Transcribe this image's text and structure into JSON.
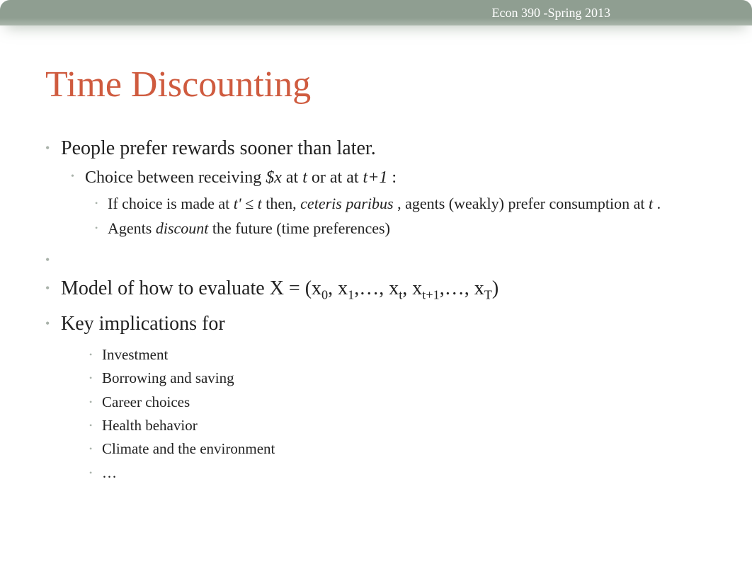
{
  "header": {
    "course": "Econ 390 -Spring 2013"
  },
  "title": "Time Discounting",
  "bullets": {
    "b1": "People prefer rewards sooner than later.",
    "b1_1_pre": "Choice between receiving ",
    "b1_1_x": "$x",
    "b1_1_at": " at ",
    "b1_1_t": "t",
    "b1_1_mid": " or at at ",
    "b1_1_t1": "t+1",
    "b1_1_colon": ":",
    "b1_1_1_a": "If choice is made at ",
    "b1_1_1_b": "t' ≤ t",
    "b1_1_1_c": " then, ",
    "b1_1_1_d": "ceteris paribus",
    "b1_1_1_e": ", agents (weakly) prefer consumption at ",
    "b1_1_1_f": "t",
    "b1_1_1_g": ".",
    "b1_1_2_a": "Agents ",
    "b1_1_2_b": "discount",
    "b1_1_2_c": " the future (time preferences)",
    "b2_a": "Model of how to evaluate ",
    "b2_b": "X = (x",
    "b2_s0": "0",
    "b2_c": ", x",
    "b2_s1": "1",
    "b2_d": ",…, x",
    "b2_st": "t",
    "b2_e": ", x",
    "b2_st1": "t+1",
    "b2_f": ",…, x",
    "b2_sT": "T",
    "b2_g": ")",
    "b3": "Key implications for",
    "b3_1": "Investment",
    "b3_2": "Borrowing and saving",
    "b3_3": "Career choices",
    "b3_4": "Health behavior",
    "b3_5": "Climate and the environment",
    "b3_6": "…"
  }
}
